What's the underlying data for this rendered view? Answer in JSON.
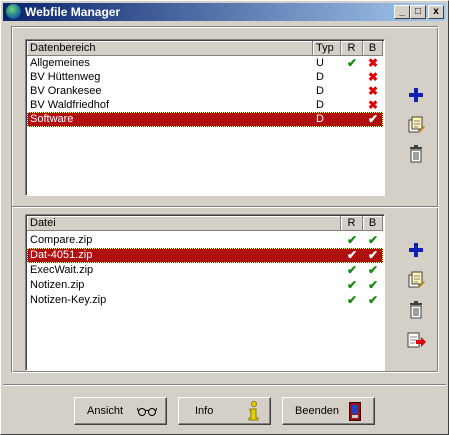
{
  "window": {
    "title": "Webfile Manager"
  },
  "titlebar_buttons": {
    "minimize": "_",
    "maximize": "□",
    "close": "x"
  },
  "areas": {
    "headers": {
      "name": "Datenbereich",
      "type": "Typ",
      "r": "R",
      "b": "B"
    },
    "rows": [
      {
        "name": "Allgemeines",
        "type": "U",
        "r": "check",
        "b": "cross"
      },
      {
        "name": "BV Hüttenweg",
        "type": "D",
        "r": "",
        "b": "cross"
      },
      {
        "name": "BV Orankesee",
        "type": "D",
        "r": "",
        "b": "cross"
      },
      {
        "name": "BV Waldfriedhof",
        "type": "D",
        "r": "",
        "b": "cross"
      },
      {
        "name": "Software",
        "type": "D",
        "r": "",
        "b": "check",
        "selected": true
      }
    ],
    "actions": [
      "add-icon",
      "edit-icon",
      "delete-icon"
    ]
  },
  "files": {
    "headers": {
      "name": "Datei",
      "r": "R",
      "b": "B"
    },
    "rows": [
      {
        "name": "Compare.zip",
        "r": "check",
        "b": "check"
      },
      {
        "name": "Dat-4051.zip",
        "r": "check",
        "b": "check",
        "selected": true
      },
      {
        "name": "ExecWait.zip",
        "r": "check",
        "b": "check"
      },
      {
        "name": "Notizen.zip",
        "r": "check",
        "b": "check"
      },
      {
        "name": "Notizen-Key.zip",
        "r": "check",
        "b": "check"
      }
    ],
    "actions": [
      "add-icon",
      "edit-icon",
      "delete-icon",
      "export-icon"
    ]
  },
  "buttons": {
    "view": {
      "label": "Ansicht",
      "icon": "glasses-icon"
    },
    "info": {
      "label": "Info",
      "icon": "info-icon"
    },
    "quit": {
      "label": "Beenden",
      "icon": "exit-door-icon"
    }
  },
  "colors": {
    "selection": "#b01010",
    "check": "#148a14",
    "cross": "#e00000",
    "add": "#1020b0"
  }
}
